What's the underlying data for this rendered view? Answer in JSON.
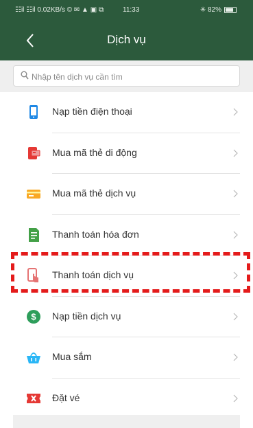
{
  "status_bar": {
    "left": "☷il ☷il 0.02KB/s © ✉ ▲ ▣ ⧉",
    "time": "11:33",
    "right": "✳ 82%"
  },
  "header": {
    "title": "Dịch vụ",
    "back_icon": "chevron-left-icon"
  },
  "search": {
    "placeholder": "Nhập tên dịch vụ cần tìm",
    "value": ""
  },
  "services": [
    {
      "label": "Nạp tiền điện thoại",
      "icon": "phone-icon",
      "color": "#1e88e5"
    },
    {
      "label": "Mua mã thẻ di động",
      "icon": "mobile-card-icon",
      "color": "#e53935"
    },
    {
      "label": "Mua mã thẻ dịch vụ",
      "icon": "service-card-icon",
      "color": "#f9a825"
    },
    {
      "label": "Thanh toán hóa đơn",
      "icon": "bill-icon",
      "color": "#43a047"
    },
    {
      "label": "Thanh toán dịch vụ",
      "icon": "pay-service-icon",
      "color": "#e57373"
    },
    {
      "label": "Nạp tiền dịch vụ",
      "icon": "dollar-icon",
      "color": "#2e9e5b"
    },
    {
      "label": "Mua sắm",
      "icon": "shopping-basket-icon",
      "color": "#29b6f6"
    },
    {
      "label": "Đặt vé",
      "icon": "ticket-icon",
      "color": "#e53935"
    }
  ],
  "highlight_color": "#e41b1b",
  "header_color": "#2c5a3c"
}
